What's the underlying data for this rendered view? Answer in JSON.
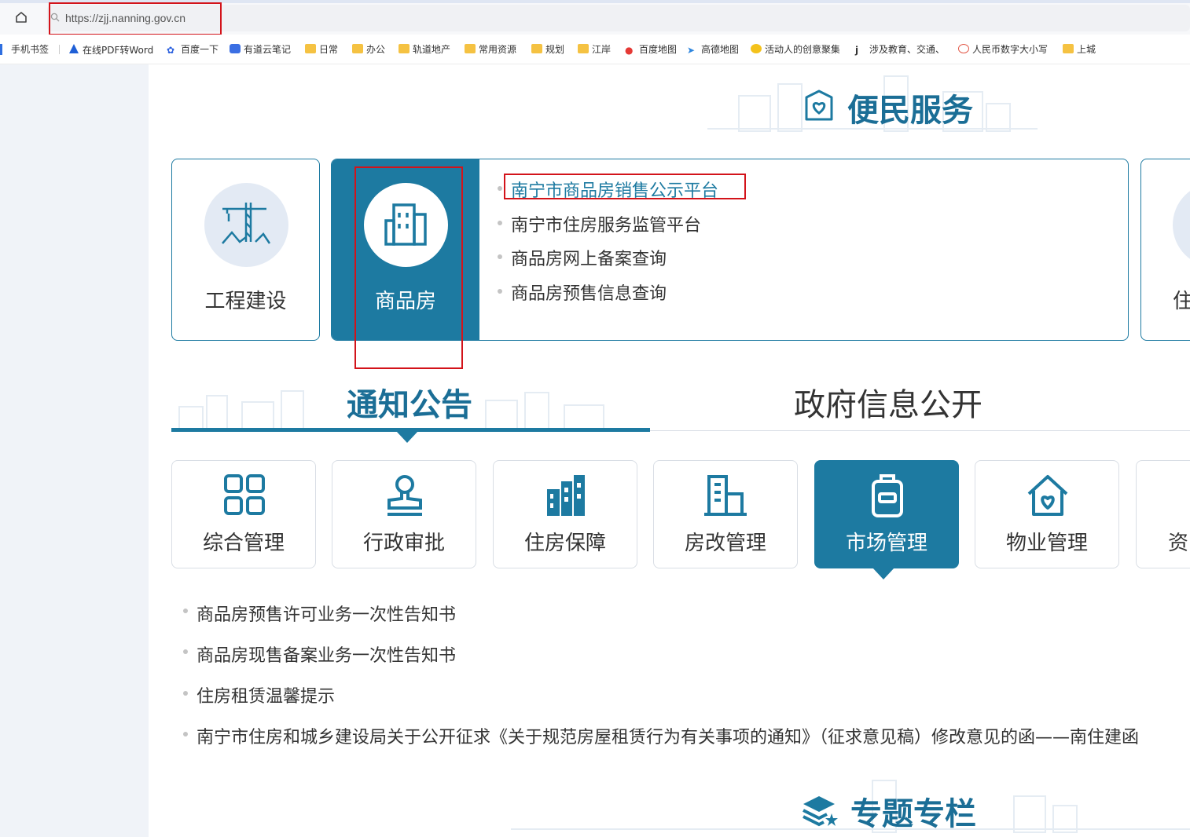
{
  "browser": {
    "url": "https://zjj.nanning.gov.cn",
    "bookmarks": [
      "手机书签",
      "在线PDF转Word",
      "百度一下",
      "有道云笔记",
      "日常",
      "办公",
      "轨道地产",
      "常用资源",
      "规划",
      "江岸",
      "百度地图",
      "高德地图",
      "活动人的创意聚集",
      "涉及教育、交通、",
      "人民币数字大小写",
      "上城"
    ]
  },
  "services": {
    "title": "便民服务",
    "cards": [
      {
        "label": "工程建设"
      },
      {
        "label": "商品房"
      },
      {
        "label": "住"
      }
    ],
    "links": [
      "南宁市商品房销售公示平台",
      "南宁市住房服务监管平台",
      "商品房网上备案查询",
      "商品房预售信息查询"
    ]
  },
  "notices": {
    "tabs": [
      "通知公告",
      "政府信息公开"
    ],
    "categories": [
      "综合管理",
      "行政审批",
      "住房保障",
      "房改管理",
      "市场管理",
      "物业管理",
      "资"
    ],
    "active_category": "市场管理",
    "items": [
      "商品房预售许可业务一次性告知书",
      "商品房现售备案业务一次性告知书",
      "住房租赁温馨提示",
      "南宁市住房和城乡建设局关于公开征求《关于规范房屋租赁行为有关事项的通知》（征求意见稿）修改意见的函——南住建函"
    ]
  },
  "special": {
    "title": "专题专栏"
  },
  "colors": {
    "brand": "#1d7aa1",
    "highlight": "#d3131a"
  }
}
